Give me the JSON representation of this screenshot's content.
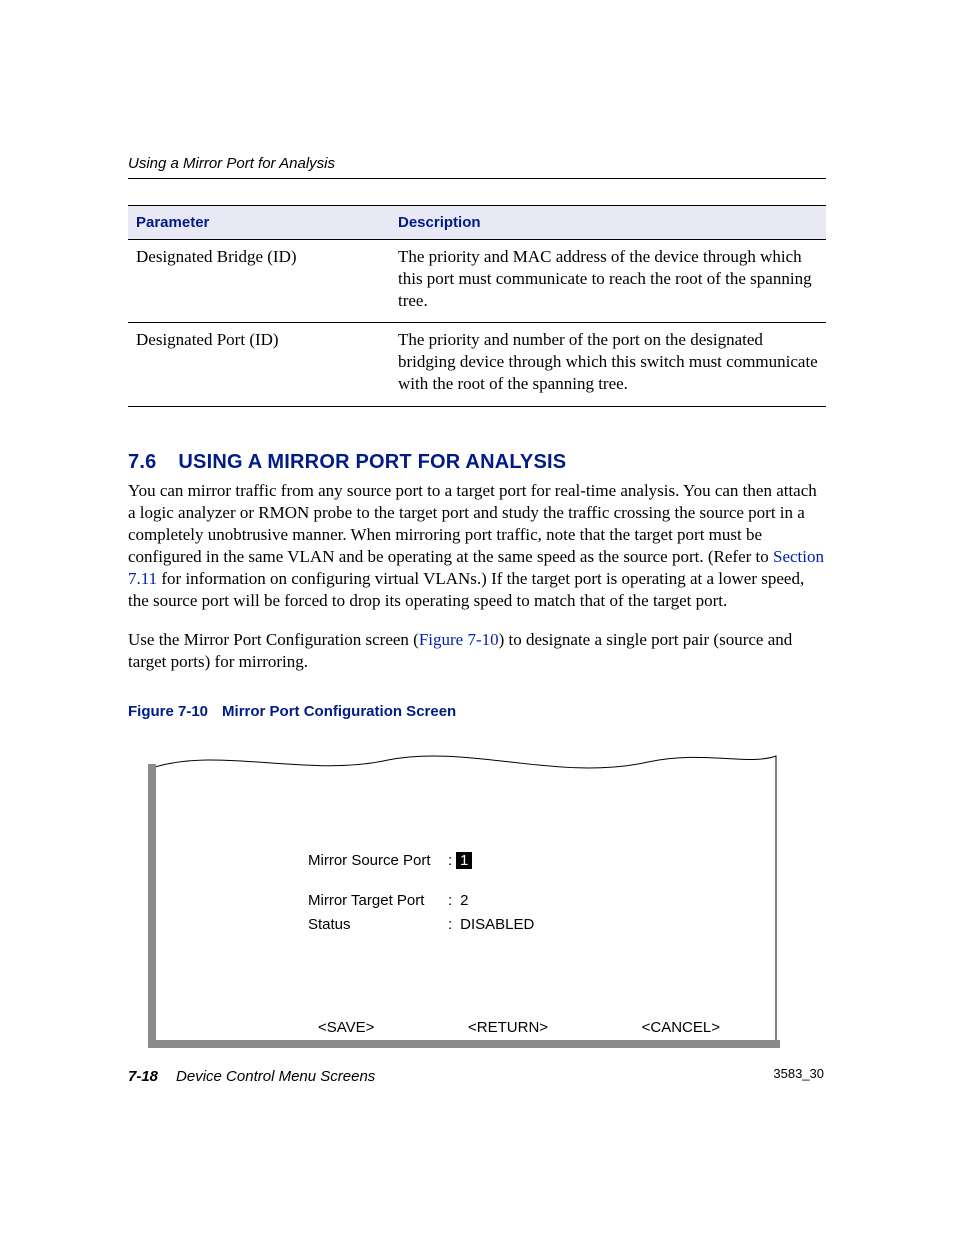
{
  "running_head": "Using a Mirror Port for Analysis",
  "table": {
    "headers": {
      "param": "Parameter",
      "desc": "Description"
    },
    "rows": [
      {
        "param": "Designated Bridge (ID)",
        "desc": "The priority and MAC address of the device through which this port must communicate to reach the root of the spanning tree."
      },
      {
        "param": "Designated Port (ID)",
        "desc": "The priority and number of the port on the designated bridging device through which this switch must communicate with the root of the spanning tree."
      }
    ]
  },
  "section": {
    "number": "7.6",
    "title": "USING A MIRROR PORT FOR ANALYSIS"
  },
  "body": {
    "p1a": "You can mirror traffic from any source port to a target port for real-time analysis. You can then attach a logic analyzer or RMON probe to the target port and study the traffic crossing the source port in a completely unobtrusive manner. When mirroring port traffic, note that the target port must be configured in the same VLAN and be operating at the same speed as the source port. (Refer to ",
    "p1_link": "Section 7.11",
    "p1b": " for information on configuring virtual VLANs.) If the target port is operating at a lower speed, the source port will be forced to drop its operating speed to match that of the target port.",
    "p2a": "Use the Mirror Port Configuration screen (",
    "p2_link": "Figure 7-10",
    "p2b": ") to designate a single port pair (source and target ports) for mirroring."
  },
  "figure": {
    "label": "Figure 7-10",
    "title": "Mirror Port Configuration Screen",
    "id": "3583_30"
  },
  "screen": {
    "fields": {
      "source_label": "Mirror Source Port",
      "source_value": "1",
      "target_label": "Mirror Target Port",
      "target_value": "2",
      "status_label": "Status",
      "status_value": "DISABLED"
    },
    "buttons": {
      "save": "<SAVE>",
      "ret": "<RETURN>",
      "cancel": "<CANCEL>"
    }
  },
  "footer": {
    "page": "7-18",
    "title": "Device Control Menu Screens"
  }
}
